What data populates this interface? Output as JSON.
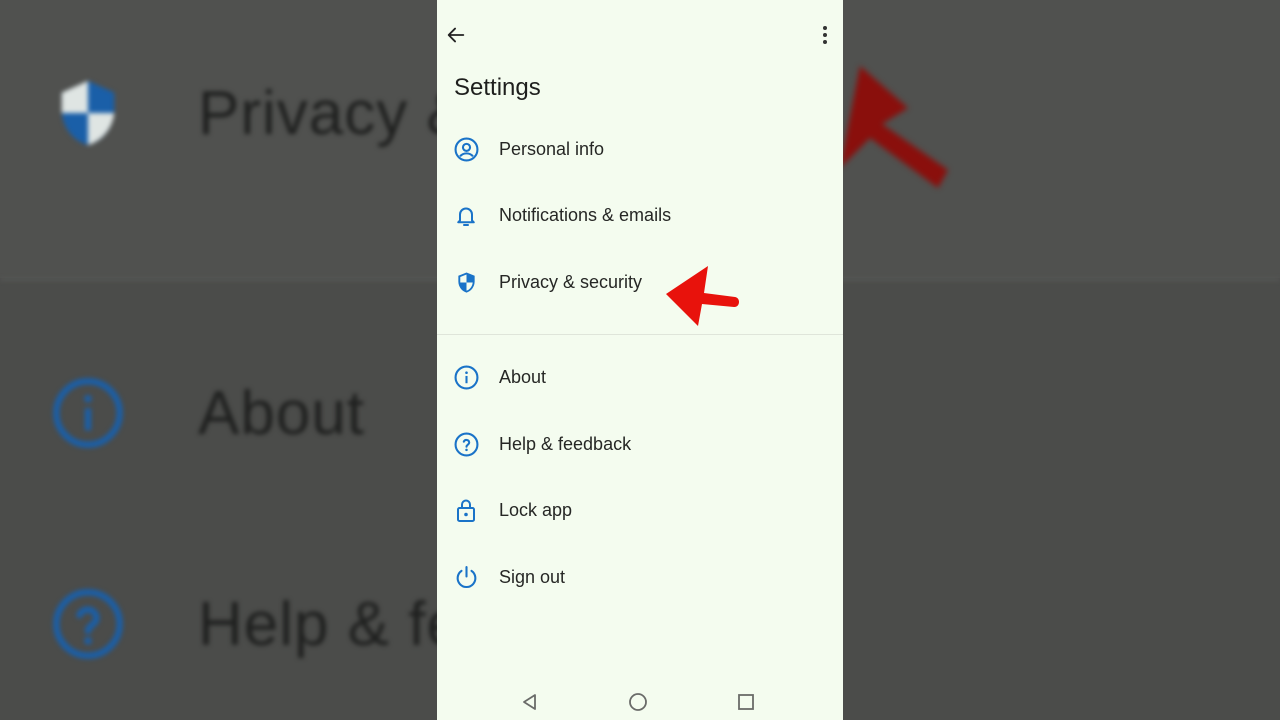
{
  "screen": {
    "title": "Settings",
    "back_icon": "arrow-left-icon",
    "more_icon": "more-vert-icon"
  },
  "menu": {
    "group1": [
      {
        "label": "Personal info",
        "icon": "account-circle-icon"
      },
      {
        "label": "Notifications & emails",
        "icon": "bell-icon"
      },
      {
        "label": "Privacy & security",
        "icon": "shield-icon"
      }
    ],
    "group2": [
      {
        "label": "About",
        "icon": "info-icon"
      },
      {
        "label": "Help & feedback",
        "icon": "help-icon"
      },
      {
        "label": "Lock app",
        "icon": "lock-icon"
      },
      {
        "label": "Sign out",
        "icon": "power-icon"
      }
    ]
  },
  "background_zoom": {
    "items": [
      "Privacy &",
      "About",
      "Help & fe"
    ]
  },
  "colors": {
    "accent": "#1a73c8",
    "pointer": "#e8120c",
    "screen_bg": "#f4fcef"
  }
}
